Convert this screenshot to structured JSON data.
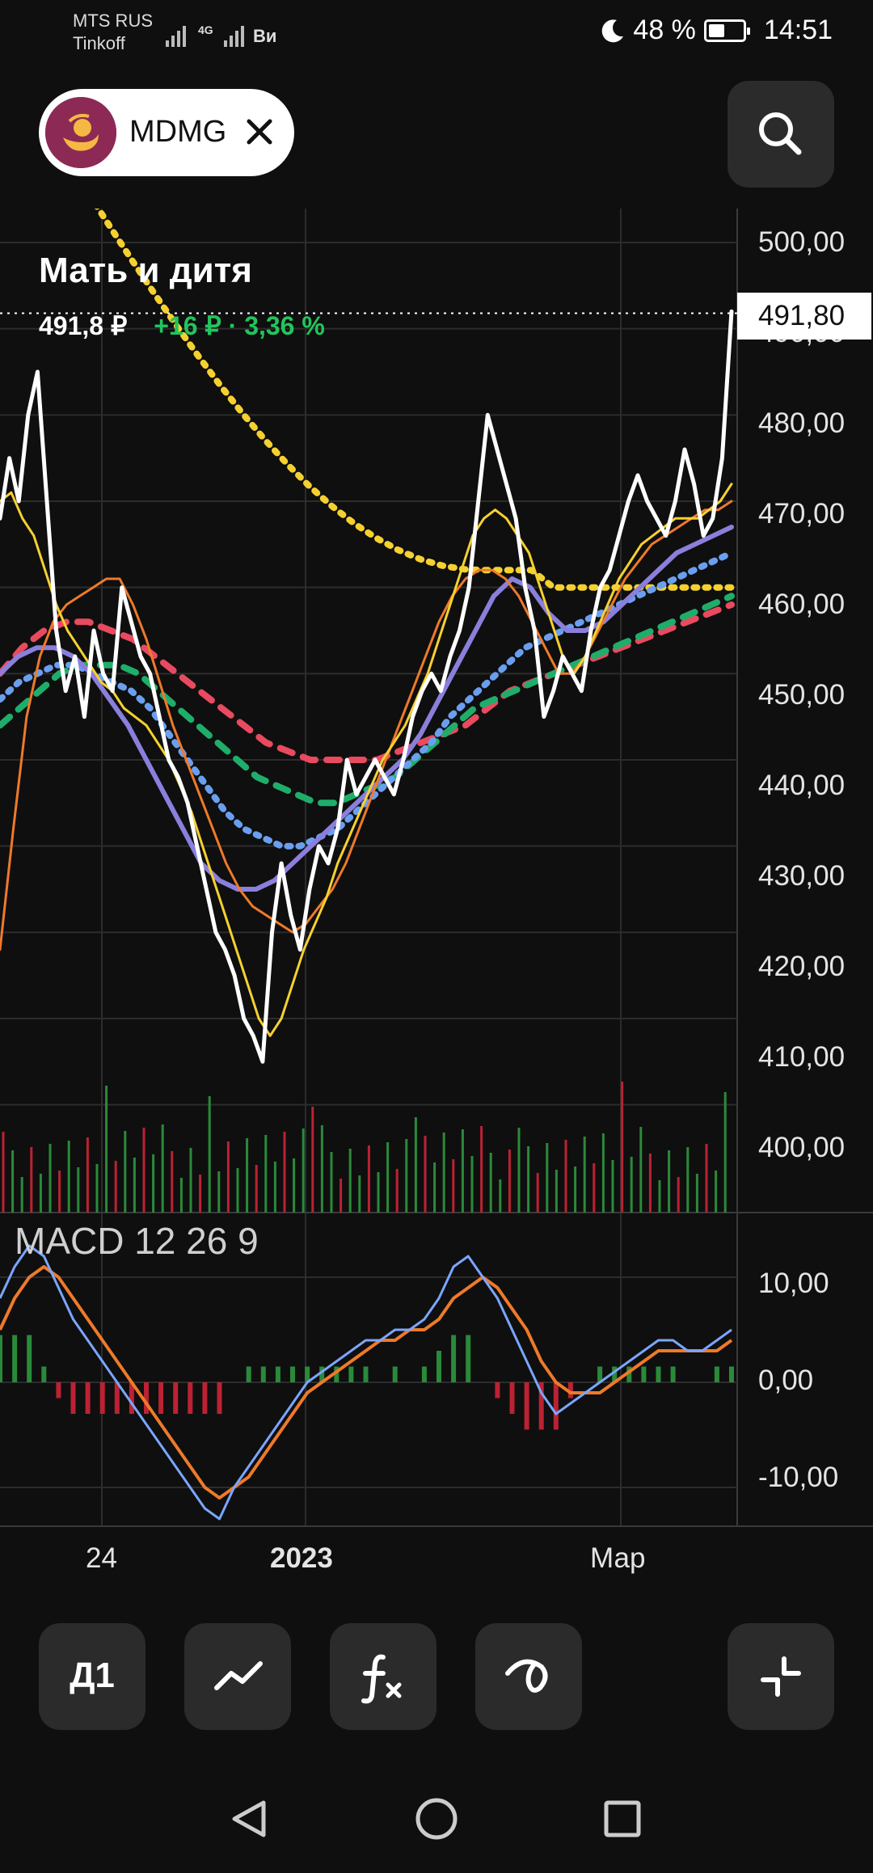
{
  "status": {
    "carrier1": "MTS RUS",
    "carrier2": "Tinkoff",
    "net": "4G",
    "extra": "Ви",
    "battery": "48 %",
    "battery_level": 0.48,
    "time": "14:51"
  },
  "header": {
    "ticker": "MDMG",
    "logo_icon": "mother-child-icon",
    "close_icon": "close-icon",
    "search_icon": "search-icon"
  },
  "instrument": {
    "name": "Мать и дитя",
    "price": "491,8 ₽",
    "change": "+16 ₽ · 3,36 %"
  },
  "price_axis": {
    "labels": [
      "500,00",
      "490,00",
      "480,00",
      "470,00",
      "460,00",
      "450,00",
      "440,00",
      "430,00",
      "420,00",
      "410,00",
      "400,00"
    ],
    "current": "491,80"
  },
  "macd": {
    "label": "MACD 12 26 9",
    "axis": [
      "10,00",
      "0,00",
      "-10,00"
    ]
  },
  "time_axis": {
    "labels": [
      "24",
      "2023",
      "Мар"
    ]
  },
  "toolbar": {
    "period": "Д1",
    "chart_type_icon": "line-chart-icon",
    "indicators_icon": "fx-icon",
    "drawing_icon": "drawing-tool-icon",
    "collapse_icon": "collapse-icon"
  },
  "colors": {
    "background": "#0f0f0f",
    "price": "#ffffff",
    "up": "#22c55e",
    "down": "#d33",
    "ma_yellow": "#f5d130",
    "ema_orange": "#ee7a2a",
    "ma_purple": "#8a7fdc",
    "ma_blue": "#6a9ff0",
    "ma_green": "#1fae6a",
    "ma_red": "#e84a5f",
    "macd_line": "#7aa6ff",
    "signal_line": "#ee7a2a"
  },
  "chart_data": {
    "type": "line",
    "price_range": [
      395,
      500
    ],
    "close": [
      468,
      475,
      470,
      480,
      485,
      470,
      455,
      448,
      452,
      445,
      455,
      450,
      448,
      460,
      456,
      452,
      450,
      445,
      440,
      438,
      435,
      430,
      425,
      420,
      418,
      415,
      410,
      408,
      405,
      420,
      428,
      422,
      418,
      425,
      430,
      428,
      432,
      440,
      436,
      438,
      440,
      438,
      436,
      440,
      445,
      448,
      450,
      448,
      452,
      455,
      460,
      470,
      480,
      476,
      472,
      468,
      460,
      455,
      445,
      448,
      452,
      450,
      448,
      455,
      460,
      462,
      466,
      470,
      473,
      470,
      468,
      466,
      470,
      476,
      472,
      466,
      468,
      475,
      492
    ],
    "ma_yellow": [
      470,
      471,
      468,
      466,
      462,
      458,
      455,
      453,
      451,
      449,
      448,
      446,
      445,
      444,
      442,
      440,
      437,
      434,
      430,
      426,
      422,
      418,
      414,
      410,
      408,
      410,
      414,
      418,
      421,
      424,
      428,
      431,
      434,
      437,
      440,
      442,
      444,
      447,
      450,
      454,
      458,
      462,
      466,
      468,
      469,
      468,
      466,
      464,
      460,
      456,
      452,
      450,
      452,
      455,
      458,
      461,
      463,
      465,
      466,
      467,
      468,
      468,
      468,
      469,
      470,
      472
    ],
    "ema_orange": [
      418,
      432,
      445,
      452,
      456,
      458,
      459,
      460,
      461,
      461,
      458,
      454,
      449,
      444,
      440,
      436,
      432,
      428,
      425,
      423,
      422,
      421,
      420,
      421,
      423,
      425,
      428,
      432,
      436,
      440,
      444,
      448,
      452,
      456,
      459,
      461,
      462,
      462,
      461,
      459,
      456,
      453,
      450,
      450,
      452,
      455,
      458,
      461,
      463,
      465,
      466,
      467,
      468,
      469,
      469,
      470
    ],
    "ma_purple": [
      450,
      452,
      453,
      453,
      452,
      450,
      447,
      444,
      440,
      436,
      432,
      428,
      426,
      425,
      425,
      426,
      428,
      430,
      432,
      434,
      436,
      438,
      440,
      443,
      447,
      451,
      455,
      459,
      461,
      460,
      457,
      455,
      455,
      456,
      458,
      460,
      462,
      464,
      465,
      466,
      467
    ],
    "ma_blue": [
      447,
      449,
      450,
      451,
      451,
      450,
      449,
      448,
      446,
      443,
      440,
      437,
      434,
      432,
      431,
      430,
      430,
      431,
      432,
      434,
      436,
      438,
      440,
      442,
      445,
      447,
      449,
      451,
      453,
      454,
      455,
      456,
      457,
      458,
      459,
      460,
      461,
      462,
      463,
      464
    ],
    "ma_green": [
      444,
      446,
      448,
      450,
      451,
      451,
      451,
      450,
      448,
      446,
      444,
      442,
      440,
      438,
      437,
      436,
      435,
      435,
      436,
      437,
      438,
      440,
      442,
      444,
      446,
      447,
      448,
      449,
      450,
      451,
      452,
      453,
      454,
      455,
      456,
      457,
      458,
      459
    ],
    "ma_red": [
      450,
      453,
      455,
      456,
      456,
      455,
      454,
      452,
      450,
      448,
      446,
      444,
      442,
      441,
      440,
      440,
      440,
      440,
      441,
      442,
      443,
      444,
      446,
      448,
      449,
      450,
      451,
      452,
      453,
      454,
      455,
      456,
      457,
      458
    ],
    "macd": [
      8,
      11,
      13,
      12,
      9,
      6,
      4,
      2,
      0,
      -2,
      -4,
      -6,
      -8,
      -10,
      -12,
      -13,
      -10,
      -8,
      -6,
      -4,
      -2,
      0,
      1,
      2,
      3,
      4,
      4,
      5,
      5,
      6,
      8,
      11,
      12,
      10,
      8,
      5,
      2,
      -1,
      -3,
      -2,
      -1,
      0,
      1,
      2,
      3,
      4,
      4,
      3,
      3,
      4,
      5
    ],
    "signal": [
      5,
      8,
      10,
      11,
      10,
      8,
      6,
      4,
      2,
      0,
      -2,
      -4,
      -6,
      -8,
      -10,
      -11,
      -10,
      -9,
      -7,
      -5,
      -3,
      -1,
      0,
      1,
      2,
      3,
      4,
      4,
      5,
      5,
      6,
      8,
      9,
      10,
      9,
      7,
      5,
      2,
      0,
      -1,
      -1,
      -1,
      0,
      1,
      2,
      3,
      3,
      3,
      3,
      3,
      4
    ],
    "volume_markers": 78
  }
}
